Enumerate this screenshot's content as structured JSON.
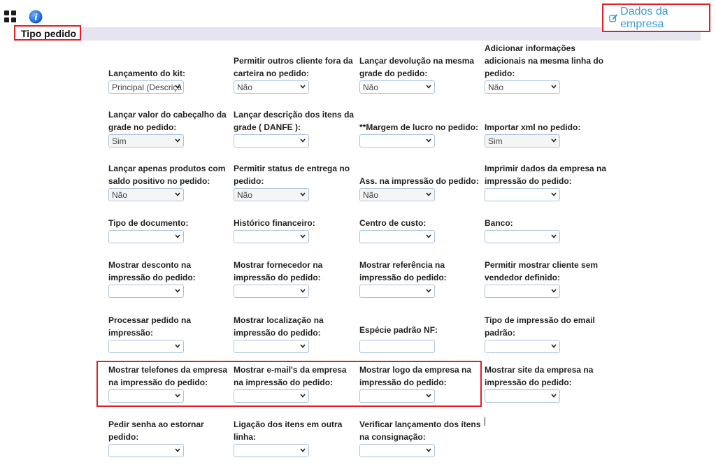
{
  "header": {
    "section_title": "Tipo pedido",
    "company_link": "Dados da empresa"
  },
  "rows": [
    [
      {
        "label": "Lançamento do kit:",
        "value": "Principal (Descriçâ",
        "style": "white"
      },
      {
        "label": "Permitir outros cliente fora da carteira no pedido:",
        "value": "Não",
        "style": "white"
      },
      {
        "label": "Lançar devolução na mesma grade do pedido:",
        "value": "Não",
        "style": "white"
      },
      {
        "label": "Adicionar informações adicionais na mesma linha do pedido:",
        "value": "Não",
        "style": "white"
      }
    ],
    [
      {
        "label": "Lançar valor do cabeçalho da grade no pedido:",
        "value": "Sim",
        "style": "gray"
      },
      {
        "label": "Lançar descrição dos itens da grade ( DANFE ):",
        "value": "",
        "style": "white"
      },
      {
        "label": "**Margem de lucro no pedido:",
        "value": "",
        "style": "white"
      },
      {
        "label": "Importar xml no pedido:",
        "value": "Sim",
        "style": "gray"
      }
    ],
    [
      {
        "label": "Lançar apenas produtos com saldo positivo no pedido:",
        "value": "Não",
        "style": "gray"
      },
      {
        "label": "Permitir status de entrega no pedido:",
        "value": "Não",
        "style": "gray"
      },
      {
        "label": "Ass. na impressão do pedido:",
        "value": "Não",
        "style": "gray"
      },
      {
        "label": "Imprimir dados da empresa na impressão do pedido:",
        "value": "",
        "style": "white"
      }
    ],
    [
      {
        "label": "Tipo de documento:",
        "value": "",
        "style": "white"
      },
      {
        "label": "Histórico financeiro:",
        "value": "",
        "style": "white"
      },
      {
        "label": "Centro de custo:",
        "value": "",
        "style": "white"
      },
      {
        "label": "Banco:",
        "value": "",
        "style": "white"
      }
    ],
    [
      {
        "label": "Mostrar desconto na impressão do pedido:",
        "value": "",
        "style": "white"
      },
      {
        "label": "Mostrar fornecedor na impressão do pedido:",
        "value": "",
        "style": "white"
      },
      {
        "label": "Mostrar referência na impressão do pedido:",
        "value": "",
        "style": "white"
      },
      {
        "label": "Permitir mostrar cliente sem vendedor definido:",
        "value": "",
        "style": "white"
      }
    ],
    [
      {
        "label": "Processar pedido na impressão:",
        "value": "",
        "style": "white"
      },
      {
        "label": "Mostrar localização na impressão do pedido:",
        "value": "",
        "style": "white"
      },
      {
        "label": "Espécie padrão NF:",
        "value": "",
        "style": "white"
      },
      {
        "label": "Tipo de impressão do email padrão:",
        "value": "",
        "style": "white"
      }
    ],
    [
      {
        "label": "Mostrar telefones da empresa na impressão do pedido:",
        "value": "",
        "style": "white"
      },
      {
        "label": "Mostrar e-mail's da empresa na impressão do pedido:",
        "value": "",
        "style": "white"
      },
      {
        "label": "Mostrar logo da empresa na impressão do pedido:",
        "value": "",
        "style": "white"
      },
      {
        "label": "Mostrar site da empresa na impressão do pedido:",
        "value": "",
        "style": "white"
      }
    ],
    [
      {
        "label": "Pedir senha ao estornar pedido:",
        "value": "",
        "style": "white"
      },
      {
        "label": "Ligação dos itens em outra linha:",
        "value": "",
        "style": "white"
      },
      {
        "label": "Verificar lançamento dos ítens na consignação:",
        "value": "",
        "style": "white"
      }
    ]
  ]
}
